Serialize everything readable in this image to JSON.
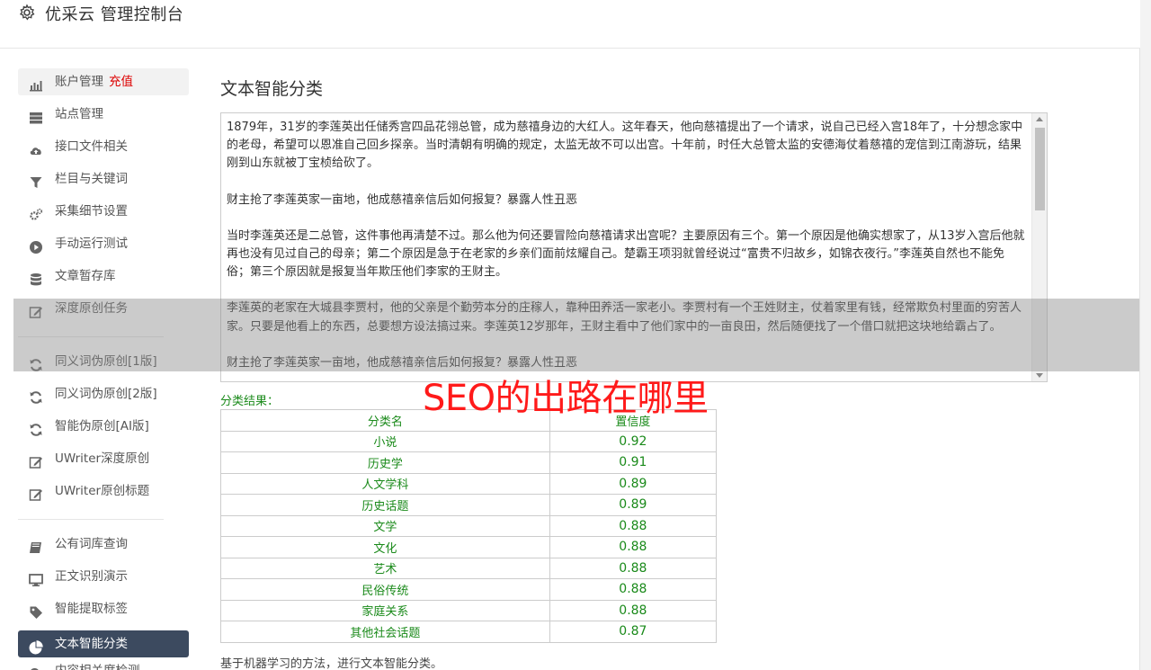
{
  "app": {
    "title": "优采云 管理控制台"
  },
  "sidebar": {
    "items": [
      {
        "label": "账户管理",
        "badge": "充值",
        "icon": "bar-chart-icon"
      },
      {
        "label": "站点管理",
        "icon": "server-icon"
      },
      {
        "label": "接口文件相关",
        "icon": "cloud-upload-icon"
      },
      {
        "label": "栏目与关键词",
        "icon": "filter-icon"
      },
      {
        "label": "采集细节设置",
        "icon": "gears-icon"
      },
      {
        "label": "手动运行测试",
        "icon": "play-circle-icon"
      },
      {
        "label": "文章暂存库",
        "icon": "database-icon"
      },
      {
        "label": "深度原创任务",
        "icon": "edit-icon"
      },
      {
        "label": "同义词伪原创[1版]",
        "icon": "refresh-icon"
      },
      {
        "label": "同义词伪原创[2版]",
        "icon": "refresh-icon"
      },
      {
        "label": "智能伪原创[AI版]",
        "icon": "refresh-icon"
      },
      {
        "label": "UWriter深度原创",
        "icon": "edit-icon"
      },
      {
        "label": "UWriter原创标题",
        "icon": "edit-icon"
      },
      {
        "label": "公有词库查询",
        "icon": "book-icon"
      },
      {
        "label": "正文识别演示",
        "icon": "monitor-icon"
      },
      {
        "label": "智能提取标签",
        "icon": "tag-icon"
      },
      {
        "label": "文本智能分类",
        "icon": "pie-chart-icon"
      },
      {
        "label": "内容相关度检测",
        "icon": "search-icon"
      }
    ]
  },
  "main": {
    "title": "文本智能分类",
    "text_paragraphs": [
      "1879年，31岁的李莲英出任储秀宫四品花翎总管，成为慈禧身边的大红人。这年春天，他向慈禧提出了一个请求，说自己已经入宫18年了，十分想念家中的老母，希望可以恩准自己回乡探亲。当时清朝有明确的规定，太监无故不可以出宫。十年前，时任大总管太监的安德海仗着慈禧的宠信到江南游玩，结果刚到山东就被丁宝桢给砍了。",
      "财主抢了李莲英家一亩地，他成慈禧亲信后如何报复？暴露人性丑恶",
      "当时李莲英还是二总管，这件事他再清楚不过。那么他为何还要冒险向慈禧请求出宫呢？主要原因有三个。第一个原因是他确实想家了，从13岁入宫后他就再也没有见过自己的母亲；第二个原因是急于在老家的乡亲们面前炫耀自己。楚霸王项羽就曾经说过“富贵不归故乡，如锦衣夜行。”李莲英自然也不能免俗；第三个原因就是报复当年欺压他们李家的王财主。",
      "李莲英的老家在大城县李贾村，他的父亲是个勤劳本分的庄稼人，靠种田养活一家老小。李贾村有一个王姓财主，仗着家里有钱，经常欺负村里面的穷苦人家。只要是他看上的东西，总要想方设法搞过来。李莲英12岁那年，王财主看中了他们家中的一亩良田，然后随便找了一个借口就把这块地给霸占了。",
      "财主抢了李莲英家一亩地，他成慈禧亲信后如何报复？暴露人性丑恶"
    ],
    "result_label": "分类结果：",
    "table": {
      "headers": [
        "分类名",
        "置信度"
      ],
      "rows": [
        [
          "小说",
          "0.92"
        ],
        [
          "历史学",
          "0.91"
        ],
        [
          "人文学科",
          "0.89"
        ],
        [
          "历史话题",
          "0.89"
        ],
        [
          "文学",
          "0.88"
        ],
        [
          "文化",
          "0.88"
        ],
        [
          "艺术",
          "0.88"
        ],
        [
          "民俗传统",
          "0.88"
        ],
        [
          "家庭关系",
          "0.88"
        ],
        [
          "其他社会话题",
          "0.87"
        ]
      ]
    },
    "footnote": "基于机器学习的方法，进行文本智能分类。"
  },
  "overlay": {
    "watermark": "SEO的出路在哪里"
  },
  "colors": {
    "active_nav": "#3c4a5f",
    "result_green": "#1a8a1a",
    "badge_red": "#dd0000",
    "watermark_red": "#ff1a1a"
  }
}
